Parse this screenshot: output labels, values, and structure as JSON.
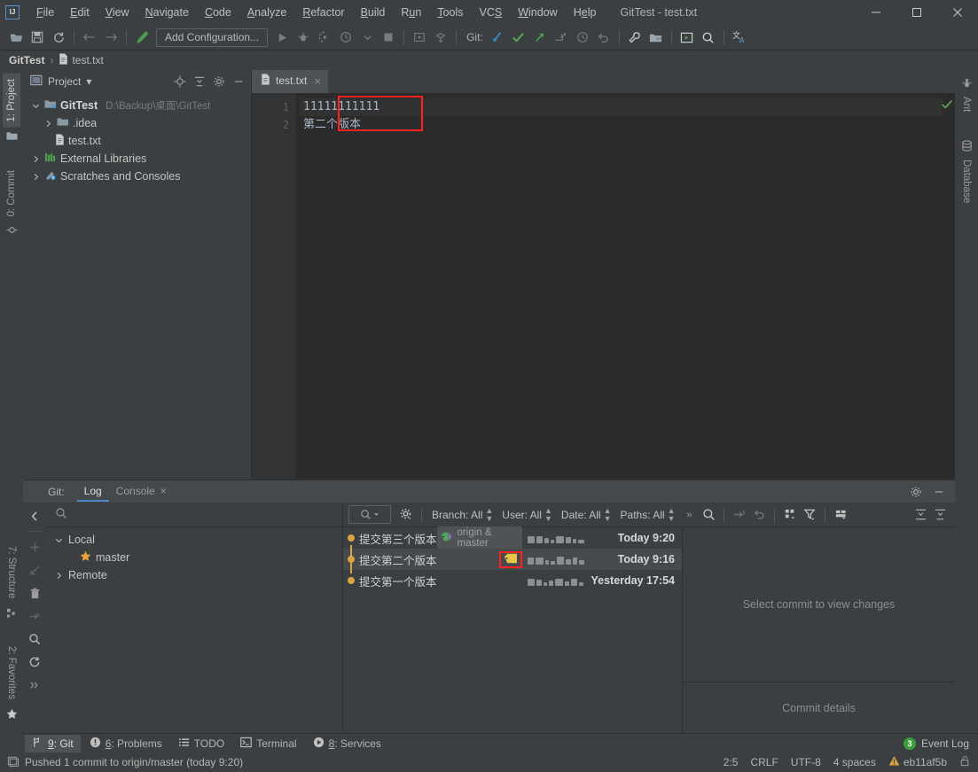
{
  "window": {
    "title": "GitTest - test.txt",
    "logo_text": "IJ",
    "minimize": "minimize-icon",
    "maximize": "maximize-icon",
    "close": "close-icon"
  },
  "menu": {
    "items": [
      {
        "label": "File",
        "mnemonic": "F"
      },
      {
        "label": "Edit",
        "mnemonic": "E"
      },
      {
        "label": "View",
        "mnemonic": "V"
      },
      {
        "label": "Navigate",
        "mnemonic": "N"
      },
      {
        "label": "Code",
        "mnemonic": "C"
      },
      {
        "label": "Analyze",
        "mnemonic": "A"
      },
      {
        "label": "Refactor",
        "mnemonic": "R"
      },
      {
        "label": "Build",
        "mnemonic": "B"
      },
      {
        "label": "Run",
        "mnemonic": "u"
      },
      {
        "label": "Tools",
        "mnemonic": "T"
      },
      {
        "label": "VCS",
        "mnemonic": "S"
      },
      {
        "label": "Window",
        "mnemonic": "W"
      },
      {
        "label": "Help",
        "mnemonic": "H"
      }
    ]
  },
  "toolbar": {
    "open_label": "open-folder-icon",
    "save_label": "save-icon",
    "sync_label": "sync-icon",
    "back_label": "back-arrow-icon",
    "forward_label": "forward-arrow-icon",
    "build_label": "build-hammer-icon",
    "run_config": "Add Configuration...",
    "run_label": "run-icon",
    "debug_label": "debug-icon",
    "run_coverage_label": "run-with-coverage-icon",
    "profile_label": "profiler-icon",
    "stop_label": "stop-icon",
    "git_label": "Git:",
    "update_label": "update-project-icon",
    "commit_label": "commit-icon",
    "push_label": "push-icon",
    "branch_label": "new-branch-icon",
    "history_label": "history-icon",
    "rollback_label": "rollback-icon",
    "settings_label": "wrench-settings-icon",
    "structure_label": "project-structure-icon",
    "idea_label": "run-anything-icon",
    "search_label": "search-everywhere-icon",
    "translate_label": "translate-icon"
  },
  "breadcrumb": {
    "project": "GitTest",
    "separator": "›",
    "file": "test.txt"
  },
  "left_strip": {
    "project_tab": "1: Project",
    "project_mnemonic": "1",
    "commit_tab": "0: Commit",
    "commit_mnemonic": "0",
    "structure_tab": "7: Structure",
    "structure_mnemonic": "7",
    "favorites_tab": "2: Favorites",
    "favorites_mnemonic": "2"
  },
  "right_strip": {
    "ant_tab": "Ant",
    "database_tab": "Database"
  },
  "project_panel": {
    "title": "Project",
    "dropdown": "▾",
    "actions": [
      "locate-icon",
      "collapse-all-icon",
      "settings-gear-icon",
      "hide-icon"
    ],
    "tree": [
      {
        "label": "GitTest",
        "path": "D:\\Backup\\桌面\\GitTest",
        "depth": 0,
        "expanded": true,
        "bold": true,
        "icon": "module-folder-icon"
      },
      {
        "label": ".idea",
        "path": "",
        "depth": 1,
        "expanded": false,
        "bold": false,
        "icon": "folder-icon"
      },
      {
        "label": "test.txt",
        "path": "",
        "depth": 2,
        "expanded": null,
        "bold": false,
        "icon": "text-file-icon"
      },
      {
        "label": "External Libraries",
        "path": "",
        "depth": 0,
        "expanded": false,
        "bold": false,
        "icon": "libraries-icon"
      },
      {
        "label": "Scratches and Consoles",
        "path": "",
        "depth": 0,
        "expanded": false,
        "bold": false,
        "icon": "scratches-icon"
      }
    ]
  },
  "editor": {
    "tab": {
      "label": "test.txt",
      "icon": "text-file-icon",
      "close": "×"
    },
    "lines": [
      {
        "no": "1",
        "text": "11111111111"
      },
      {
        "no": "2",
        "text": "第二个版本"
      }
    ],
    "inspection_status": "ok-check-icon",
    "highlight_color": "#ff2020"
  },
  "git_tool": {
    "label": "Git:",
    "tabs": [
      {
        "label": "Log",
        "active": true,
        "closable": false
      },
      {
        "label": "Console",
        "active": false,
        "closable": true,
        "close": "×"
      }
    ],
    "header_actions": [
      "settings-gear-icon",
      "hide-icon"
    ],
    "side_actions": [
      "collapse-sidebar-icon",
      "add-icon",
      "checkout-icon",
      "delete-icon",
      "merge-icon",
      "search-icon",
      "refresh-icon",
      "more-icon"
    ],
    "branch_search_placeholder": "",
    "branch_tree": [
      {
        "label": "Local",
        "depth": 0,
        "expanded": true,
        "icon": "chevron-down-icon"
      },
      {
        "label": "master",
        "depth": 1,
        "expanded": null,
        "icon": "star-icon"
      },
      {
        "label": "Remote",
        "depth": 0,
        "expanded": false,
        "icon": "chevron-right-icon"
      }
    ],
    "filters": [
      {
        "label": "Branch: All"
      },
      {
        "label": "User: All"
      },
      {
        "label": "Date: All"
      },
      {
        "label": "Paths: All"
      }
    ],
    "toolbar_icons": [
      "search-dropdown-icon",
      "gear-dropdown-icon",
      "overflow-icon",
      "search-icon",
      "cherry-pick-icon",
      "revert-icon",
      "show-graph-icon",
      "filter-icon",
      "column-layout-icon",
      "expand-icon",
      "collapse-icon"
    ],
    "commits": [
      {
        "subject": "提交第三个版本",
        "refs": "origin & master",
        "has_ref_chip": true,
        "has_tag": false,
        "tag_boxed": false,
        "time": "Today 9:20",
        "selected": false
      },
      {
        "subject": "提交第二个版本",
        "refs": "",
        "has_ref_chip": false,
        "has_tag": true,
        "tag_boxed": true,
        "time": "Today 9:16",
        "selected": true
      },
      {
        "subject": "提交第一个版本",
        "refs": "",
        "has_ref_chip": false,
        "has_tag": false,
        "tag_boxed": false,
        "time": "Yesterday 17:54",
        "selected": false
      }
    ],
    "details": {
      "empty_changes": "Select commit to view changes",
      "commit_details": "Commit details"
    }
  },
  "tool_window_bar": {
    "buttons": [
      {
        "label": "9: Git",
        "mnemonic": "9",
        "icon": "git-branch-icon",
        "active": true
      },
      {
        "label": "6: Problems",
        "mnemonic": "6",
        "icon": "problems-icon",
        "active": false
      },
      {
        "label": "TODO",
        "mnemonic": "",
        "icon": "todo-list-icon",
        "active": false
      },
      {
        "label": "Terminal",
        "mnemonic": "",
        "icon": "terminal-icon",
        "active": false
      },
      {
        "label": "8: Services",
        "mnemonic": "8",
        "icon": "services-icon",
        "active": false
      }
    ],
    "event_log": {
      "label": "Event Log",
      "count": "3",
      "badge_color": "#3c9e3c"
    }
  },
  "status_bar": {
    "message": "Pushed 1 commit to origin/master (today 9:20)",
    "message_icon": "memory-indicator-icon",
    "caret": "2:5",
    "line_separator": "CRLF",
    "encoding": "UTF-8",
    "indent": "4 spaces",
    "branch": "eb11af5b",
    "branch_icon": "warning-triangle-icon",
    "lock_icon": "read-write-lock-icon"
  }
}
